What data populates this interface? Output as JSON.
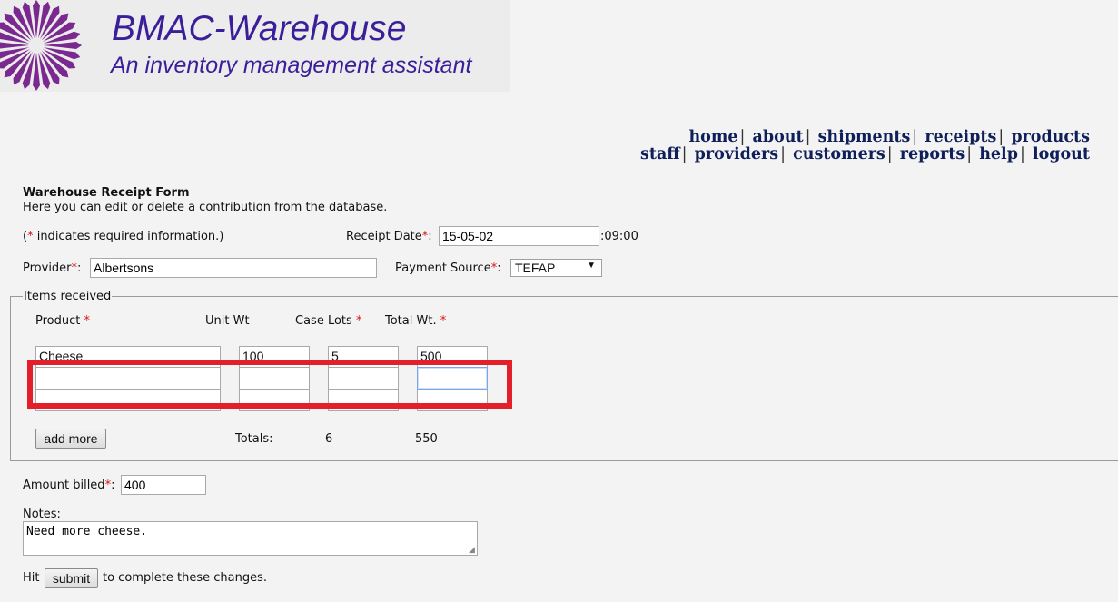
{
  "app": {
    "title": "BMAC-Warehouse",
    "subtitle": "An inventory management assistant",
    "logo_color": "#7a2a8e"
  },
  "nav": {
    "row1": [
      "home",
      "about",
      "shipments",
      "receipts",
      "products"
    ],
    "row2": [
      "staff",
      "providers",
      "customers",
      "reports",
      "help",
      "logout"
    ],
    "separator": "|"
  },
  "form": {
    "title": "Warehouse Receipt Form",
    "description": "Here you can edit or delete a contribution from the database.",
    "required_note_prefix": "(",
    "required_note_star": "*",
    "required_note_suffix": " indicates required information.)",
    "receipt_date_label": "Receipt Date",
    "receipt_date_value": "15-05-02",
    "receipt_time": ":09:00",
    "provider_label": "Provider",
    "provider_value": "Albertsons",
    "payment_source_label": "Payment Source",
    "payment_source_value": "TEFAP",
    "items_legend": "Items received",
    "columns": {
      "product": "Product",
      "unit_wt": "Unit Wt",
      "case_lots": "Case Lots",
      "total_wt": "Total Wt."
    },
    "rows": [
      {
        "product": "Cheese",
        "unit_wt": "100",
        "case_lots": "5",
        "total_wt": "500"
      },
      {
        "product": "",
        "unit_wt": "",
        "case_lots": "",
        "total_wt": ""
      },
      {
        "product": "",
        "unit_wt": "",
        "case_lots": "",
        "total_wt": ""
      }
    ],
    "add_more_label": "add more",
    "totals_label": "Totals:",
    "totals_case_lots": "6",
    "totals_weight": "550",
    "amount_billed_label": "Amount billed",
    "amount_billed_value": "400",
    "notes_label": "Notes:",
    "notes_value": "Need more cheese.",
    "hit_text": "Hit",
    "submit_label": "submit",
    "complete_text": "to complete these changes.",
    "star": "*",
    "colon": ":"
  },
  "colors": {
    "title_color": "#3a1e9a",
    "required_star": "#d11111",
    "highlight_box": "#e3202a",
    "nav_link": "#0f1f5a"
  }
}
